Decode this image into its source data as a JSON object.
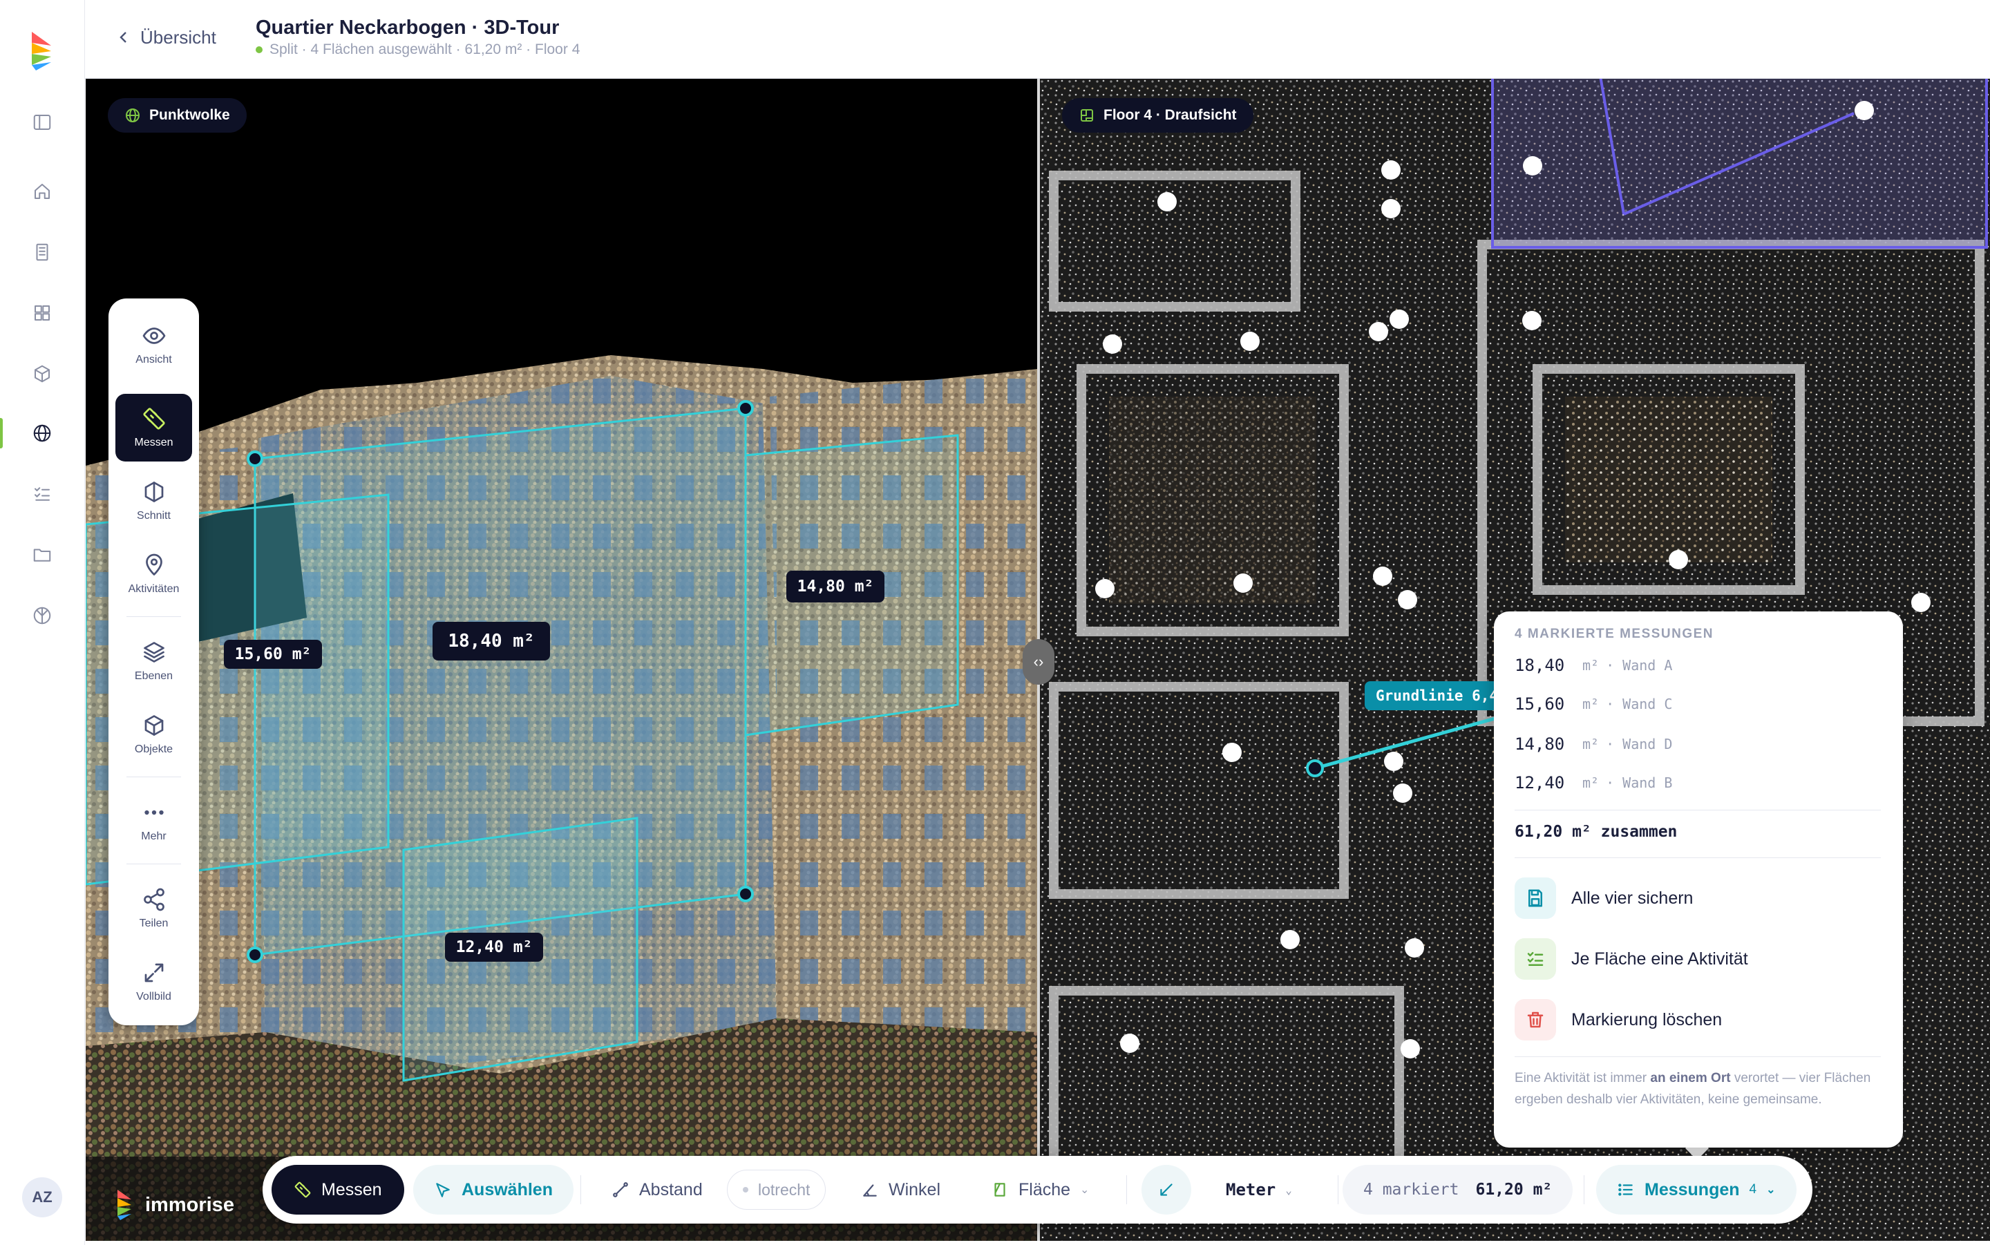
{
  "app": {
    "brand": "immorise",
    "user_initials": "AZ"
  },
  "header": {
    "back_label": "Übersicht",
    "title": "Quartier Neckarbogen · 3D-Tour",
    "subtitle": "Split · 4 Flächen ausgewählt · 61,20 m² · Floor 4"
  },
  "rail": {
    "items": [
      {
        "icon": "sidebar-toggle-icon"
      },
      {
        "icon": "home-icon"
      },
      {
        "icon": "building-icon"
      },
      {
        "icon": "grid-icon"
      },
      {
        "icon": "cube-icon"
      },
      {
        "icon": "globe-icon",
        "active": true
      },
      {
        "icon": "checklist-icon"
      },
      {
        "icon": "folder-icon"
      },
      {
        "icon": "network-icon"
      }
    ],
    "accent": "#7ec544"
  },
  "left_view": {
    "chip": "Punktwolke"
  },
  "right_view": {
    "chip": "Floor 4 · Draufsicht",
    "baseline_label": "Grundlinie 6,4"
  },
  "palette": {
    "tools": [
      {
        "label": "Ansicht",
        "icon": "eye-icon"
      },
      {
        "label": "Messen",
        "icon": "ruler-icon",
        "active": true
      },
      {
        "label": "Schnitt",
        "icon": "section-icon"
      },
      {
        "label": "Aktivitäten",
        "icon": "pin-icon"
      },
      {
        "label": "Ebenen",
        "icon": "layers-icon"
      },
      {
        "label": "Objekte",
        "icon": "object-cube-icon"
      },
      {
        "label": "Mehr",
        "icon": "more-icon"
      },
      {
        "label": "Teilen",
        "icon": "share-icon"
      },
      {
        "label": "Vollbild",
        "icon": "fullscreen-icon"
      }
    ]
  },
  "measure_labels": [
    "18,40 m²",
    "15,60 m²",
    "14,80 m²",
    "12,40 m²"
  ],
  "popup": {
    "heading": "4 MARKIERTE MESSUNGEN",
    "rows": [
      {
        "value": "18,40",
        "unit": "m²",
        "wall": "· Wand A"
      },
      {
        "value": "15,60",
        "unit": "m²",
        "wall": "· Wand C"
      },
      {
        "value": "14,80",
        "unit": "m²",
        "wall": "· Wand D"
      },
      {
        "value": "12,40",
        "unit": "m²",
        "wall": "· Wand B"
      }
    ],
    "total": "61,20  m² zusammen",
    "actions": [
      {
        "label": "Alle vier sichern",
        "icon": "save-icon"
      },
      {
        "label": "Je Fläche eine Aktivität",
        "icon": "checklist-icon"
      },
      {
        "label": "Markierung löschen",
        "icon": "trash-icon"
      }
    ],
    "note_pre": "Eine Aktivität ist immer ",
    "note_bold": "an einem Ort",
    "note_post": " verortet — vier Flächen ergeben deshalb vier Aktivitäten, keine gemeinsame."
  },
  "toolbar": {
    "messen": "Messen",
    "auswaehlen": "Auswählen",
    "abstand": "Abstand",
    "lotrecht": "lotrecht",
    "winkel": "Winkel",
    "flaeche": "Fläche",
    "unit": "Meter",
    "marked_count": "4 markiert",
    "marked_total": "61,20 m²",
    "measurements": "Messungen",
    "measurements_count": "4"
  },
  "colors": {
    "accent_cyan": "#33d1d9",
    "accent_green": "#7ec544",
    "dark": "#0e1126",
    "teal_label": "#0a8fa8"
  }
}
